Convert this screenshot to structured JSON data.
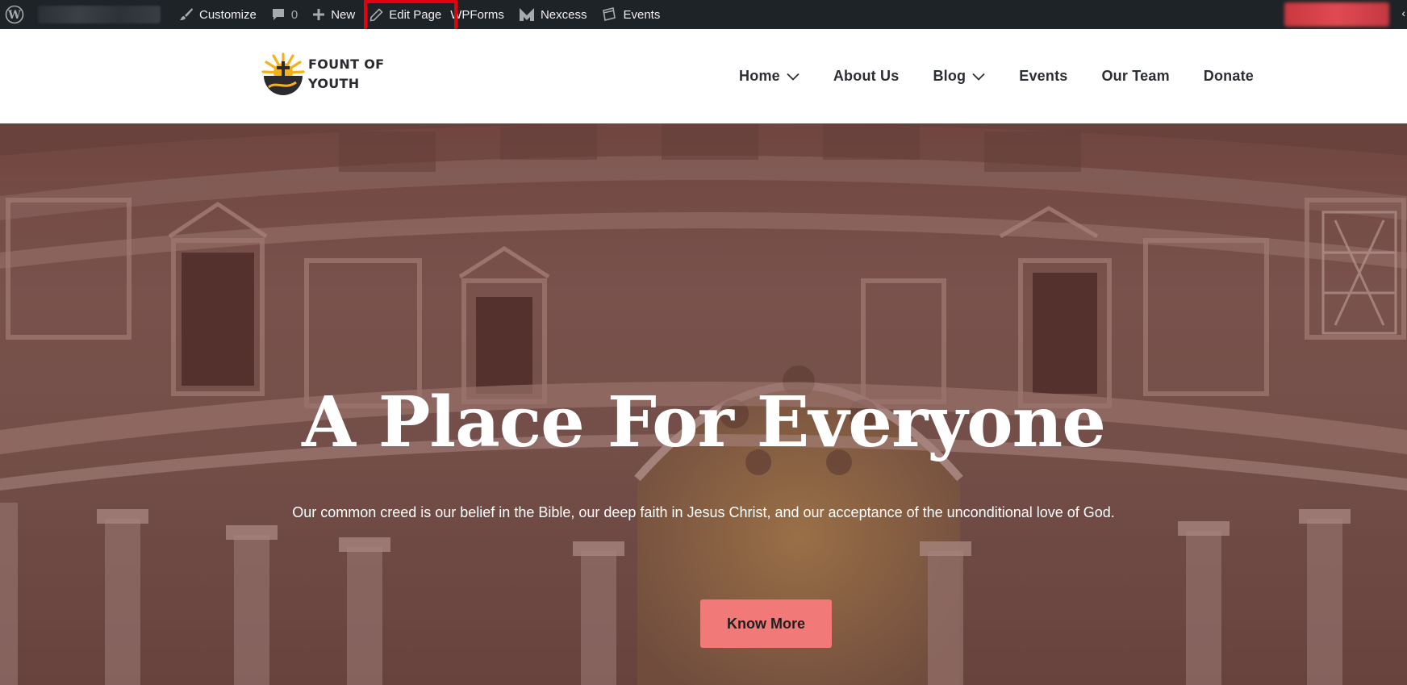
{
  "adminbar": {
    "customize": "Customize",
    "comments_count": "0",
    "new": "New",
    "edit_page": "Edit Page",
    "wpforms": "WPForms",
    "nexcess": "Nexcess",
    "events": "Events"
  },
  "header": {
    "logo_line1": "FOUNT OF",
    "logo_line2": "YOUTH",
    "nav": {
      "home": "Home",
      "about": "About Us",
      "blog": "Blog",
      "events": "Events",
      "team": "Our Team",
      "donate": "Donate"
    }
  },
  "hero": {
    "title": "A Place For Everyone",
    "subtitle": "Our common creed is our belief in the Bible, our deep faith in Jesus Christ, and our acceptance of the unconditional love of God.",
    "button": "Know More"
  },
  "colors": {
    "adminbar_bg": "#1d2327",
    "highlight": "#e3000f",
    "button_bg": "#f17a78",
    "logo_yellow": "#f3b21a",
    "logo_dark": "#2b2b2f"
  },
  "icons": [
    "wordpress-icon",
    "paintbrush-icon",
    "comment-icon",
    "plus-icon",
    "pencil-icon",
    "nexcess-icon",
    "events-icon",
    "chevron-down-icon",
    "logo-cross-icon"
  ]
}
